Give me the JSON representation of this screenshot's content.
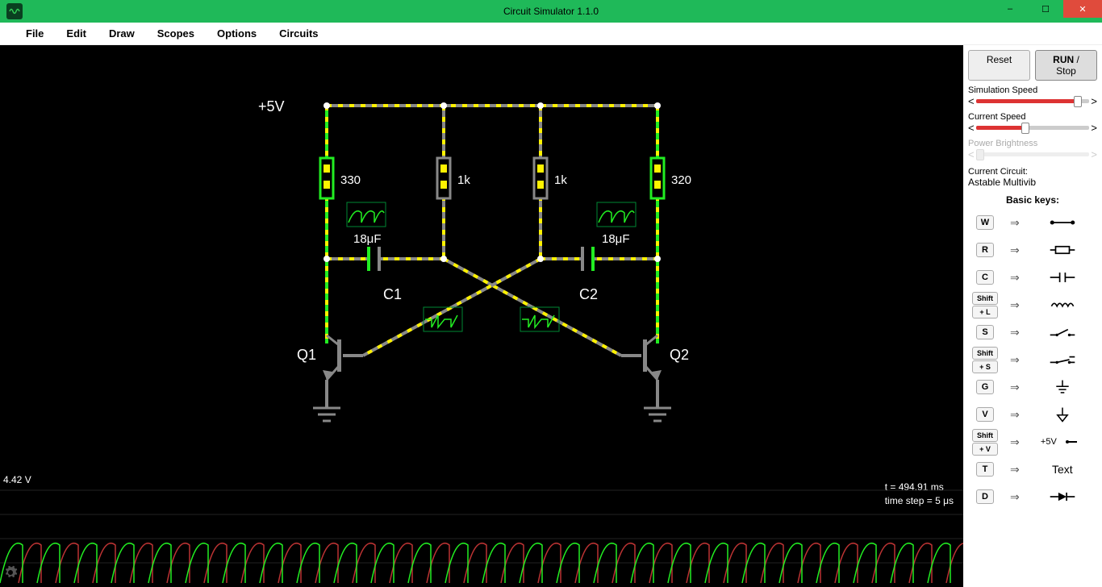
{
  "window": {
    "title": "Circuit Simulator 1.1.0"
  },
  "menu": {
    "items": [
      "File",
      "Edit",
      "Draw",
      "Scopes",
      "Options",
      "Circuits"
    ]
  },
  "controls": {
    "reset": "Reset",
    "run_stop": "RUN / Stop",
    "sim_speed_label": "Simulation Speed",
    "current_speed_label": "Current Speed",
    "power_brightness_label": "Power Brightness",
    "current_circuit_label": "Current Circuit:",
    "current_circuit_value": "Astable Multivib",
    "basic_keys_label": "Basic keys:"
  },
  "keys": [
    {
      "k": "W",
      "sym": "wire"
    },
    {
      "k": "R",
      "sym": "resistor"
    },
    {
      "k": "C",
      "sym": "capacitor"
    },
    {
      "k": "Shift+L",
      "sym": "inductor"
    },
    {
      "k": "S",
      "sym": "switch-open"
    },
    {
      "k": "Shift+S",
      "sym": "switch-closed"
    },
    {
      "k": "G",
      "sym": "ground"
    },
    {
      "k": "V",
      "sym": "ground2"
    },
    {
      "k": "Shift+V",
      "sym": "voltage"
    },
    {
      "k": "T",
      "sym": "text"
    },
    {
      "k": "D",
      "sym": "diode"
    }
  ],
  "circuit": {
    "voltage_label": "+5V",
    "r1": "330",
    "r2": "1k",
    "r3": "1k",
    "r4": "320",
    "c1_val": "18μF",
    "c2_val": "18μF",
    "c1_label": "C1",
    "c2_label": "C2",
    "q1_label": "Q1",
    "q2_label": "Q2"
  },
  "scope": {
    "voltage": "4.42 V",
    "time": "t = 494.91 ms",
    "timestep": "time step = 5 μs"
  },
  "key_text": {
    "voltage": "+5V",
    "text": "Text"
  }
}
